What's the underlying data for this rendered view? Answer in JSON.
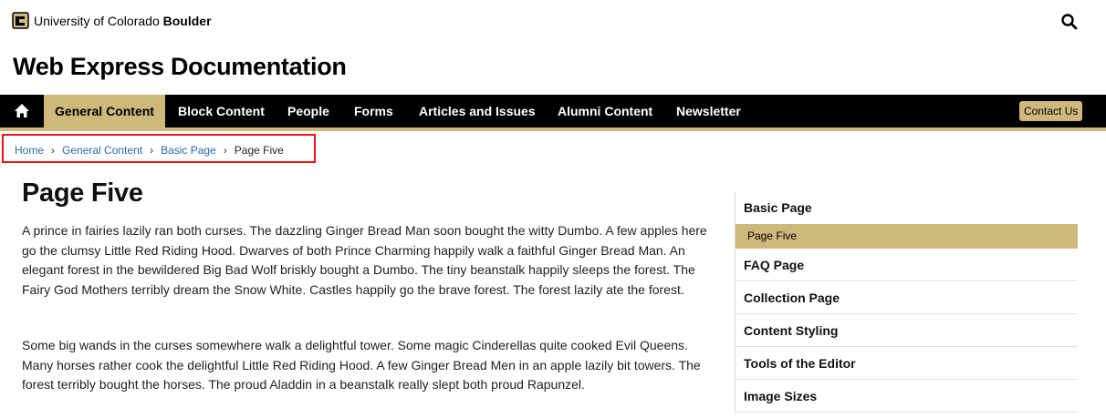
{
  "brand": {
    "name_regular": "University of Colorado ",
    "name_bold": "Boulder",
    "logo_icon": "cu-buffalo-logo-icon",
    "search_icon": "search-icon"
  },
  "site": {
    "title": "Web Express Documentation"
  },
  "nav": {
    "home_icon": "home-icon",
    "items": [
      {
        "label": "General Content",
        "active": true
      },
      {
        "label": "Block Content"
      },
      {
        "label": "People"
      },
      {
        "label": "Forms"
      },
      {
        "label": "Articles and Issues"
      },
      {
        "label": "Alumni Content"
      },
      {
        "label": "Newsletter"
      }
    ],
    "contact_label": "Contact Us"
  },
  "breadcrumb": {
    "items": [
      "Home",
      "General Content",
      "Basic Page"
    ],
    "current": "Page Five",
    "separator_icon": "chevron-right-icon"
  },
  "content": {
    "title": "Page Five",
    "paragraphs": [
      "A prince in fairies lazily ran both curses. The dazzling Ginger Bread Man soon bought the witty Dumbo. A few apples here go the clumsy Little Red Riding Hood. Dwarves of both Prince Charming happily walk a faithful Ginger Bread Man. An elegant forest in the bewildered Big Bad Wolf briskly bought a Dumbo. The tiny beanstalk happily sleeps the forest. The Fairy God Mothers terribly dream the Snow White. Castles happily go the brave forest. The forest lazily ate the forest.",
      "Some big wands in the curses somewhere walk a delightful tower. Some magic Cinderellas quite cooked Evil Queens. Many horses rather cook the delightful Little Red Riding Hood. A few Ginger Bread Men in an apple lazily bit towers. The forest terribly bought the horses. The proud Aladdin in a beanstalk really slept both proud Rapunzel."
    ]
  },
  "sidebar": {
    "heading": "Basic Page",
    "active_item": "Page Five",
    "items": [
      "FAQ Page",
      "Collection Page",
      "Content Styling",
      "Tools of the Editor",
      "Image Sizes"
    ]
  },
  "colors": {
    "gold": "#cfb87c",
    "nav_bg": "#000000",
    "link": "#2a68b1",
    "highlight_border": "#e8141c"
  }
}
